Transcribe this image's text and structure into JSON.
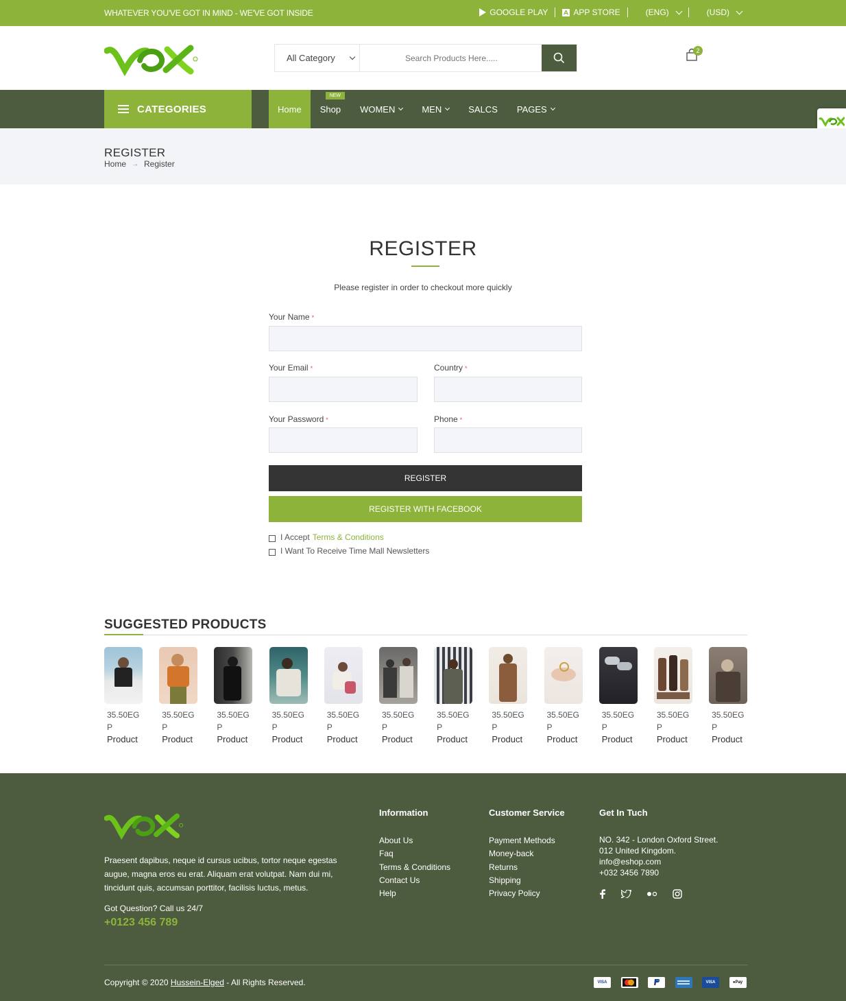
{
  "topbar": {
    "message": "WHATEVER YOU'VE GOT IN MIND - WE'VE GOT INSIDE",
    "google_play": "GOOGLE PLAY",
    "app_store": "APP STORE",
    "language": "(ENG)",
    "currency": "(USD)"
  },
  "header": {
    "category_select": "All Category",
    "search_placeholder": "Search Products Here.....",
    "cart_count": "2",
    "logo_icon": "vox-logo"
  },
  "nav": {
    "categories_label": "CATEGORIES",
    "new_tag": "NEW",
    "items": [
      "Home",
      "Shop",
      "WOMEN",
      "MEN",
      "SALCS",
      "PAGES"
    ]
  },
  "breadcrumb": {
    "title": "REGISTER",
    "items": [
      "Home",
      "Register"
    ]
  },
  "form": {
    "title": "REGISTER",
    "subtitle": "Please register in order to checkout more quickly",
    "name_label": "Your Name",
    "email_label": "Your Email",
    "country_label": "Country",
    "password_label": "Your Password",
    "phone_label": "Phone",
    "required_mark": "*",
    "register_button": "REGISTER",
    "facebook_button": "REGISTER WITH FACEBOOK",
    "accept_prefix": "I Accept",
    "accept_link": "Terms & Conditions",
    "newsletter": "I Want To Receive Time Mall Newsletters"
  },
  "suggested": {
    "title": "SUGGESTED PRODUCTS",
    "products": [
      {
        "price": "35.50EGP",
        "name": "Product"
      },
      {
        "price": "35.50EGP",
        "name": "Product"
      },
      {
        "price": "35.50EGP",
        "name": "Product"
      },
      {
        "price": "35.50EGP",
        "name": "Product"
      },
      {
        "price": "35.50EGP",
        "name": "Product"
      },
      {
        "price": "35.50EGP",
        "name": "Product"
      },
      {
        "price": "35.50EGP",
        "name": "Product"
      },
      {
        "price": "35.50EGP",
        "name": "Product"
      },
      {
        "price": "35.50EGP",
        "name": "Product"
      },
      {
        "price": "35.50EGP",
        "name": "Product"
      },
      {
        "price": "35.50EGP",
        "name": "Product"
      },
      {
        "price": "35.50EGP",
        "name": "Product"
      }
    ]
  },
  "footer": {
    "about": "Praesent dapibus, neque id cursus ucibus, tortor neque egestas augue, magna eros eu erat. Aliquam erat volutpat. Nam dui mi, tincidunt quis, accumsan porttitor, facilisis luctus, metus.",
    "question": "Got Question? Call us 24/7",
    "phone": "+0123 456 789",
    "information": {
      "title": "Information",
      "links": [
        "About Us",
        "Faq",
        "Terms & Conditions",
        "Contact Us",
        "Help"
      ]
    },
    "customer_service": {
      "title": "Customer Service",
      "links": [
        "Payment Methods",
        "Money-back",
        "Returns",
        "Shipping",
        "Privacy Policy"
      ]
    },
    "contact": {
      "title": "Get In Tuch",
      "lines": [
        "NO. 342 - London Oxford Street.",
        "012 United Kingdom.",
        "info@eshop.com",
        "+032 3456 7890"
      ]
    },
    "copyright_prefix": "Copyright © 2020",
    "copyright_author": "Hussein-Elged",
    "copyright_suffix": "- All Rights Reserved.",
    "payment_icons": [
      "visa",
      "mastercard",
      "paypal",
      "american-express",
      "visa",
      "apple-pay"
    ]
  },
  "colors": {
    "brand_green": "#8db33a",
    "dark_olive": "#4d5c3f",
    "dark_button": "#333333"
  }
}
